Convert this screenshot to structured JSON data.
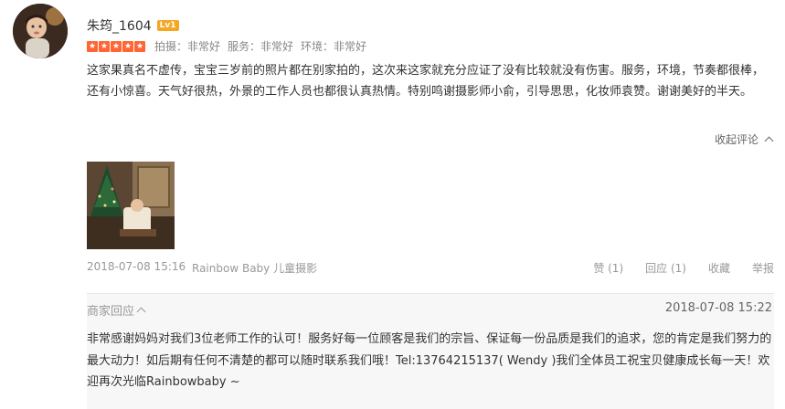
{
  "review": {
    "username": "朱筠_1604",
    "level_badge": "Lv1",
    "stars": 5,
    "ratings": [
      {
        "label": "拍摄：非常好"
      },
      {
        "label": "服务：非常好"
      },
      {
        "label": "环境：非常好"
      }
    ],
    "text": "这家果真名不虚传，宝宝三岁前的照片都在别家拍的，这次来这家就充分应证了没有比较就没有伤害。服务，环境，节奏都很棒，还有小惊喜。天气好很热，外景的工作人员也都很认真热情。特别鸣谢摄影师小俞，引导思思，化妆师袁赞。谢谢美好的半天。",
    "collapse_label": "收起评论",
    "date": "2018-07-08 15:16",
    "shop_name": "Rainbow Baby 儿童摄影",
    "actions": {
      "like": "赞 (1)",
      "reply": "回应 (1)",
      "favorite": "收藏",
      "report": "举报"
    }
  },
  "merchant_reply": {
    "title": "商家回应",
    "date": "2018-07-08 15:22",
    "text": "非常感谢妈妈对我们3位老师工作的认可！服务好每一位顾客是我们的宗旨、保证每一份品质是我们的追求，您的肯定是我们努力的最大动力！如后期有任何不清楚的都可以随时联系我们哦！Tel:13764215137( Wendy )我们全体员工祝宝贝健康成长每一天！欢迎再次光临Rainbowbaby ~"
  },
  "colors": {
    "star": "#ff6633",
    "badge": "#f5a623",
    "reply_bg": "#f7f7f7"
  }
}
